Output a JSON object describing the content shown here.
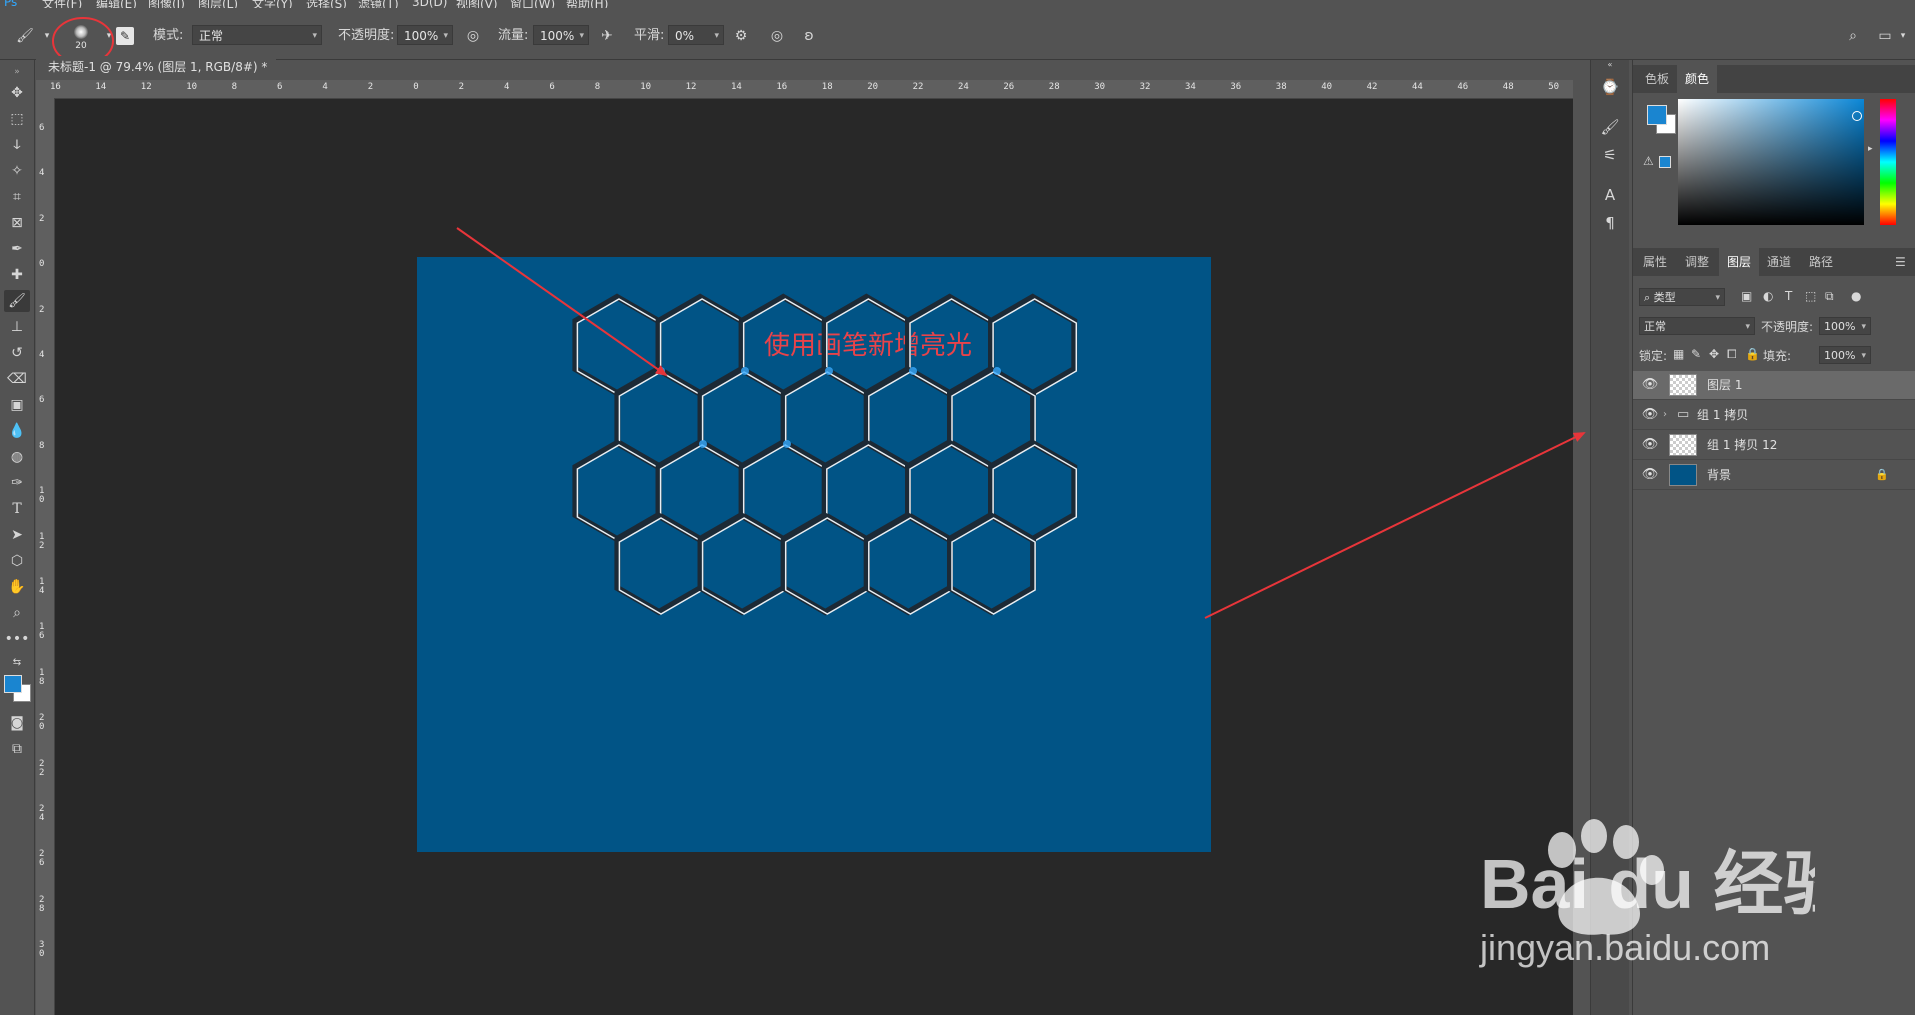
{
  "menu": {
    "items": [
      "文件(F)",
      "编辑(E)",
      "图像(I)",
      "图层(L)",
      "文字(Y)",
      "选择(S)",
      "滤镜(T)",
      "3D(D)",
      "视图(V)",
      "窗口(W)",
      "帮助(H)"
    ]
  },
  "options_bar": {
    "brush_size": "20",
    "mode_label": "模式:",
    "mode_value": "正常",
    "opacity_label": "不透明度:",
    "opacity_value": "100%",
    "flow_label": "流量:",
    "flow_value": "100%",
    "smoothing_label": "平滑:",
    "smoothing_value": "0%"
  },
  "document": {
    "tab_title": "未标题-1 @ 79.4% (图层 1, RGB/8#) *",
    "close_glyph": "×",
    "canvas_caption": "使用画笔新增亮光",
    "background_color": "#015486"
  },
  "rulers": {
    "horizontal_labels": [
      "16",
      "14",
      "12",
      "10",
      "8",
      "6",
      "4",
      "2",
      "0",
      "2",
      "4",
      "6",
      "8",
      "10",
      "12",
      "14",
      "16",
      "18",
      "20",
      "22",
      "24",
      "26",
      "28",
      "30",
      "32",
      "34",
      "36",
      "38",
      "40",
      "42",
      "44",
      "46",
      "48",
      "50"
    ],
    "vertical_labels": [
      "6",
      "4",
      "2",
      "0",
      "2",
      "4",
      "6",
      "8",
      "10",
      "12",
      "14",
      "16",
      "18",
      "20",
      "22",
      "24",
      "26",
      "28",
      "30"
    ]
  },
  "color_panel": {
    "tabs": [
      "色板",
      "颜色"
    ],
    "active_tab": "颜色",
    "foreground": "#1a85d0",
    "background": "#ffffff"
  },
  "layers_panel": {
    "tabs": [
      "属性",
      "调整",
      "图层",
      "通道",
      "路径"
    ],
    "active_tab": "图层",
    "filter_kind": "类型",
    "blend_mode": "正常",
    "opacity_label": "不透明度:",
    "opacity_value": "100%",
    "lock_label": "锁定:",
    "fill_label": "填充:",
    "fill_value": "100%",
    "layers": [
      {
        "name": "图层 1",
        "selected": true
      },
      {
        "name": "组 1 拷贝",
        "selected": false
      },
      {
        "name": "组 1 拷贝 12",
        "selected": false
      },
      {
        "name": "背景",
        "selected": false
      }
    ]
  },
  "watermark": {
    "brand": "Bai du 经验",
    "url": "jingyan.baidu.com"
  },
  "annotation": {
    "arrow_color": "#e8353a",
    "circle_color": "#e8353a"
  }
}
